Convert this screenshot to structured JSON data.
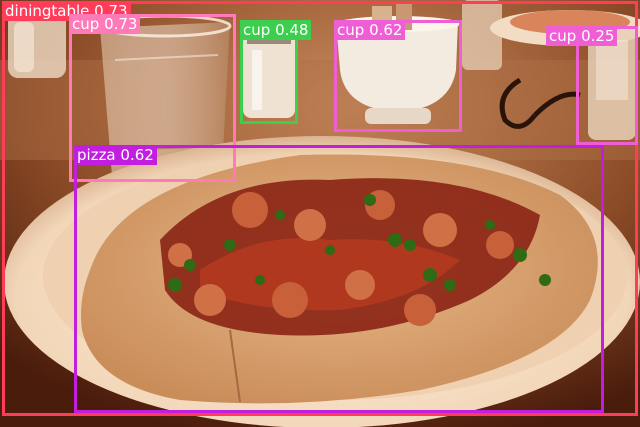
{
  "detections": [
    {
      "label": "diningtable",
      "score": "0.73",
      "color": "#ff3c5a"
    },
    {
      "label": "cup",
      "score": "0.73",
      "color": "#ff7ab8"
    },
    {
      "label": "cup",
      "score": "0.48",
      "color": "#3ccf4e"
    },
    {
      "label": "cup",
      "score": "0.62",
      "color": "#f05ed6"
    },
    {
      "label": "cup",
      "score": "0.25",
      "color": "#f05ed6"
    },
    {
      "label": "pizza",
      "score": "0.62",
      "color": "#c21ee0"
    }
  ]
}
